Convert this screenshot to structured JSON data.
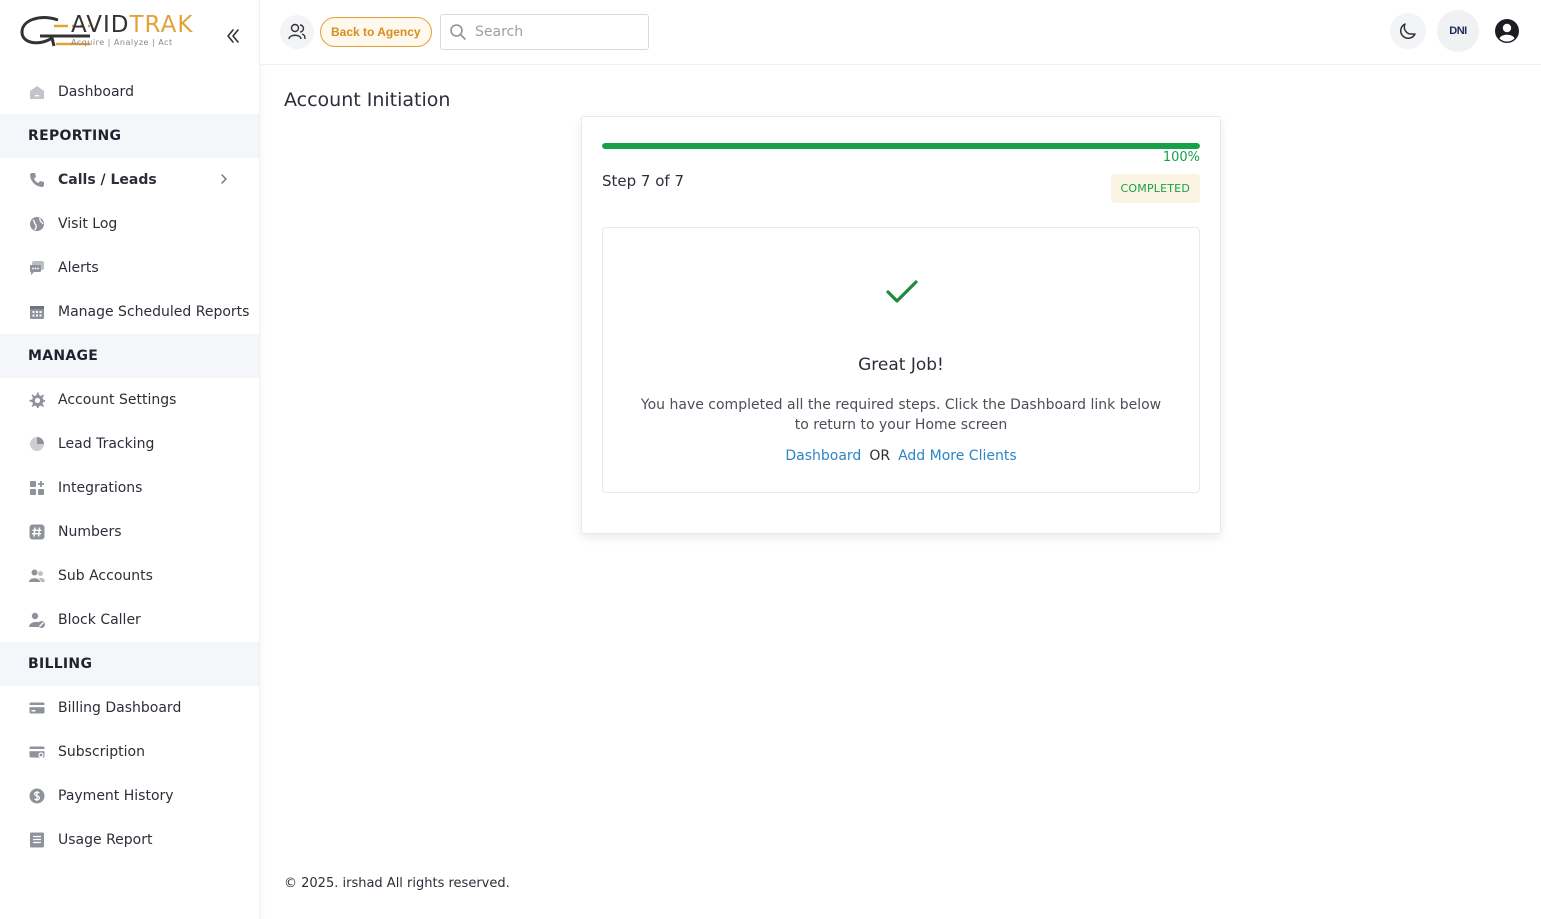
{
  "brand": {
    "name_left": "AVID",
    "name_right": "TRAK",
    "tagline": "Acquire  |  Analyze  |  Act"
  },
  "sidebar": {
    "items": [
      {
        "label": "Dashboard",
        "icon": "home-icon"
      },
      {
        "section": "REPORTING"
      },
      {
        "label": "Calls / Leads",
        "icon": "phone-icon",
        "bold": true,
        "chevron": true
      },
      {
        "label": "Visit Log",
        "icon": "globe-icon"
      },
      {
        "label": "Alerts",
        "icon": "chat-icon"
      },
      {
        "label": "Manage Scheduled Reports",
        "icon": "calendar-icon"
      },
      {
        "section": "MANAGE"
      },
      {
        "label": "Account Settings",
        "icon": "gear-icon"
      },
      {
        "label": "Lead Tracking",
        "icon": "pie-icon"
      },
      {
        "label": "Integrations",
        "icon": "grid-plus-icon"
      },
      {
        "label": "Numbers",
        "icon": "hash-icon"
      },
      {
        "label": "Sub Accounts",
        "icon": "users-icon"
      },
      {
        "label": "Block Caller",
        "icon": "user-block-icon"
      },
      {
        "section": "BILLING"
      },
      {
        "label": "Billing Dashboard",
        "icon": "card-icon"
      },
      {
        "label": "Subscription",
        "icon": "card-refresh-icon"
      },
      {
        "label": "Payment History",
        "icon": "dollar-icon"
      },
      {
        "label": "Usage Report",
        "icon": "list-icon"
      }
    ]
  },
  "header": {
    "back_label": "Back to Agency",
    "search_placeholder": "Search",
    "dni_label": "DNI"
  },
  "main": {
    "title": "Account Initiation",
    "progress_percent": 100,
    "progress_label": "100%",
    "step_label": "Step 7 of 7",
    "status": "COMPLETED",
    "heading": "Great Job!",
    "message": "You have completed all the required steps. Click the Dashboard link below to return to your Home screen",
    "link_dashboard": "Dashboard",
    "or_text": "OR",
    "link_add_clients": "Add More Clients"
  },
  "footer": {
    "text": "© 2025. irshad All rights reserved."
  },
  "colors": {
    "accent": "#e2a23b",
    "success": "#17a04a",
    "link": "#2d86c4",
    "icon_gray": "#8e939b"
  }
}
